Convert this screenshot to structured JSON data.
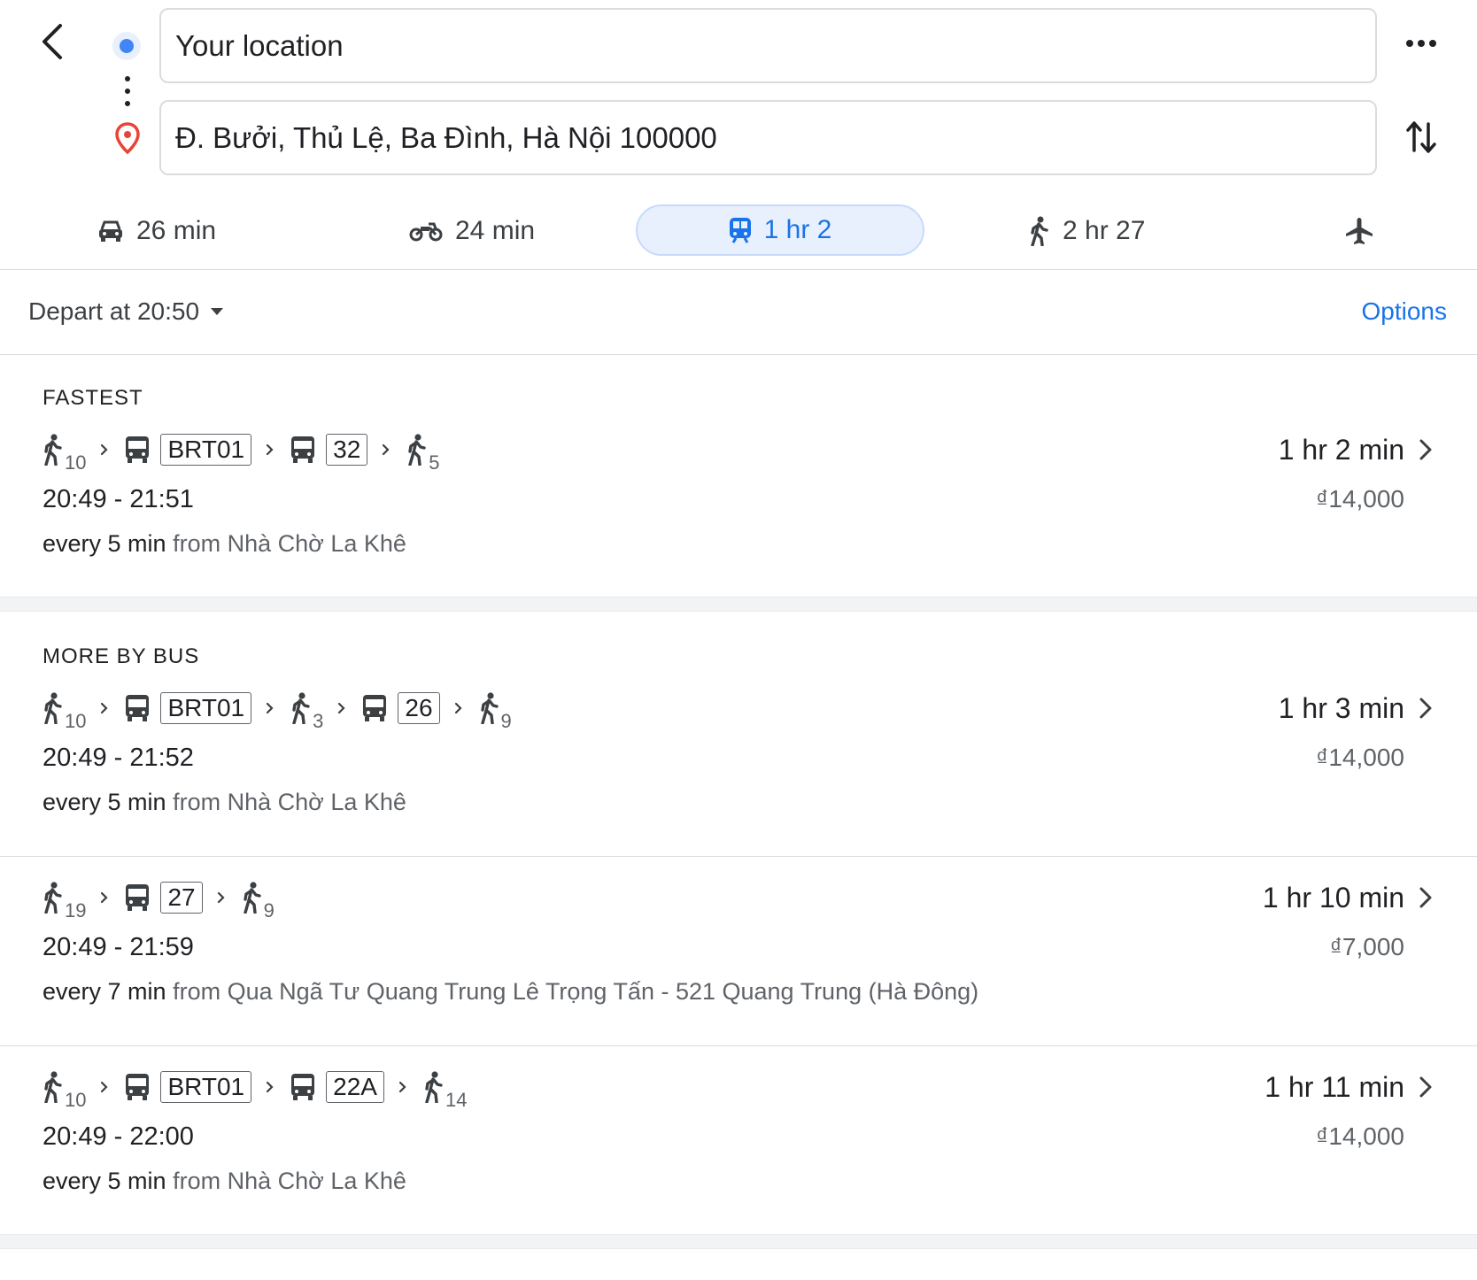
{
  "header": {
    "origin_value": "Your location",
    "destination_value": "Đ. Bưởi, Thủ Lệ, Ba Đình, Hà Nội 100000"
  },
  "modes": [
    {
      "icon": "car-icon",
      "label": "26 min"
    },
    {
      "icon": "motorbike-icon",
      "label": "24 min"
    },
    {
      "icon": "transit-icon",
      "label": "1 hr 2",
      "active": true
    },
    {
      "icon": "walk-icon",
      "label": "2 hr 27"
    },
    {
      "icon": "flight-icon",
      "label": ""
    }
  ],
  "depart": {
    "label": "Depart at 20:50",
    "options_label": "Options"
  },
  "colors": {
    "accent": "#1a73e8",
    "active_bg": "#e8f0fe",
    "origin_dot": "#4285f4",
    "destination_pin": "#ea4335"
  },
  "sections": {
    "fastest": "FASTEST",
    "more_by_bus": "MORE BY BUS"
  },
  "routes": [
    {
      "steps": [
        {
          "type": "walk",
          "minutes": "10"
        },
        {
          "type": "bus",
          "line": "BRT01"
        },
        {
          "type": "bus",
          "line": "32"
        },
        {
          "type": "walk",
          "minutes": "5"
        }
      ],
      "duration": "1 hr 2 min",
      "times": "20:49 - 21:51",
      "fare": "₫14,000",
      "frequency": "every 5 min",
      "from": "from Nhà Chờ La Khê"
    },
    {
      "steps": [
        {
          "type": "walk",
          "minutes": "10"
        },
        {
          "type": "bus",
          "line": "BRT01"
        },
        {
          "type": "walk",
          "minutes": "3"
        },
        {
          "type": "bus",
          "line": "26"
        },
        {
          "type": "walk",
          "minutes": "9"
        }
      ],
      "duration": "1 hr 3 min",
      "times": "20:49 - 21:52",
      "fare": "₫14,000",
      "frequency": "every 5 min",
      "from": "from Nhà Chờ La Khê"
    },
    {
      "steps": [
        {
          "type": "walk",
          "minutes": "19"
        },
        {
          "type": "bus",
          "line": "27"
        },
        {
          "type": "walk",
          "minutes": "9"
        }
      ],
      "duration": "1 hr 10 min",
      "times": "20:49 - 21:59",
      "fare": "₫7,000",
      "frequency": "every 7 min",
      "from": "from Qua Ngã Tư Quang Trung Lê Trọng Tấn - 521 Quang Trung (Hà Đông)"
    },
    {
      "steps": [
        {
          "type": "walk",
          "minutes": "10"
        },
        {
          "type": "bus",
          "line": "BRT01"
        },
        {
          "type": "bus",
          "line": "22A"
        },
        {
          "type": "walk",
          "minutes": "14"
        }
      ],
      "duration": "1 hr 11 min",
      "times": "20:49 - 22:00",
      "fare": "₫14,000",
      "frequency": "every 5 min",
      "from": "from Nhà Chờ La Khê"
    }
  ]
}
